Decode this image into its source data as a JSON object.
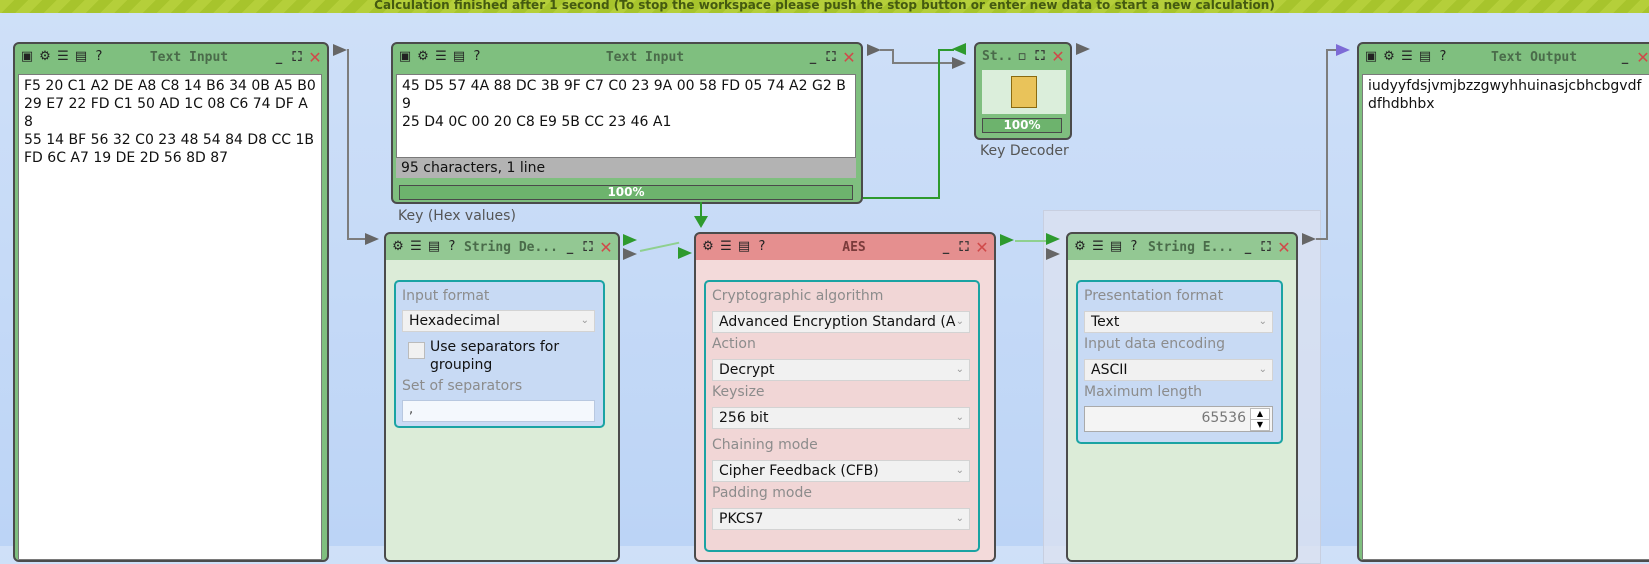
{
  "status_bar": "Calculation finished after 1 second (To stop the workspace please push the stop button or enter new data to start a new calculation)",
  "text_input_1": {
    "title": "Text Input",
    "content": "F5 20 C1 A2 DE A8 C8 14 B6 34 0B A5 B0\n29 E7 22 FD C1 50 AD 1C 08 C6 74 DF A8\n55 14 BF 56 32 C0 23 48 54 84 D8 CC 1B\nFD 6C A7 19 DE 2D 56 8D 87"
  },
  "text_input_2": {
    "title": "Text Input",
    "content": "45 D5 57 4A 88 DC 3B 9F C7 C0 23 9A 00 58 FD 05 74 A2 G2 B9\n25 D4 0C 00 20 C8 E9 5B CC 23 46 A1",
    "status": "95 characters,  1 line",
    "progress": "100%",
    "caption": "Key (Hex values)"
  },
  "key_decoder": {
    "title": "St...",
    "progress": "100%",
    "caption": "Key Decoder"
  },
  "string_decoder": {
    "title": "String De...",
    "input_format_label": "Input format",
    "input_format_value": "Hexadecimal",
    "separators_checkbox_label": "Use separators for grouping",
    "set_of_separators_label": "Set of separators",
    "set_of_separators_value": ","
  },
  "aes": {
    "title": "AES",
    "algorithm_label": "Cryptographic algorithm",
    "algorithm_value": "Advanced Encryption Standard (A",
    "action_label": "Action",
    "action_value": "Decrypt",
    "keysize_label": "Keysize",
    "keysize_value": "256 bit",
    "chaining_label": "Chaining mode",
    "chaining_value": "Cipher Feedback (CFB)",
    "padding_label": "Padding mode",
    "padding_value": "PKCS7"
  },
  "string_encoder": {
    "title": "String E...",
    "presentation_label": "Presentation format",
    "presentation_value": "Text",
    "encoding_label": "Input data encoding",
    "encoding_value": "ASCII",
    "maxlen_label": "Maximum length",
    "maxlen_value": "65536"
  },
  "text_output": {
    "title": "Text Output",
    "content": "iudyyfdsjvmjbzzgwyhhuinasjcbhcbgvdf\ndfhdbhbx"
  },
  "colors": {
    "accent_green": "#2e9a2e",
    "aes_red": "#e58f8f",
    "settings_border": "#1aa3a3"
  }
}
